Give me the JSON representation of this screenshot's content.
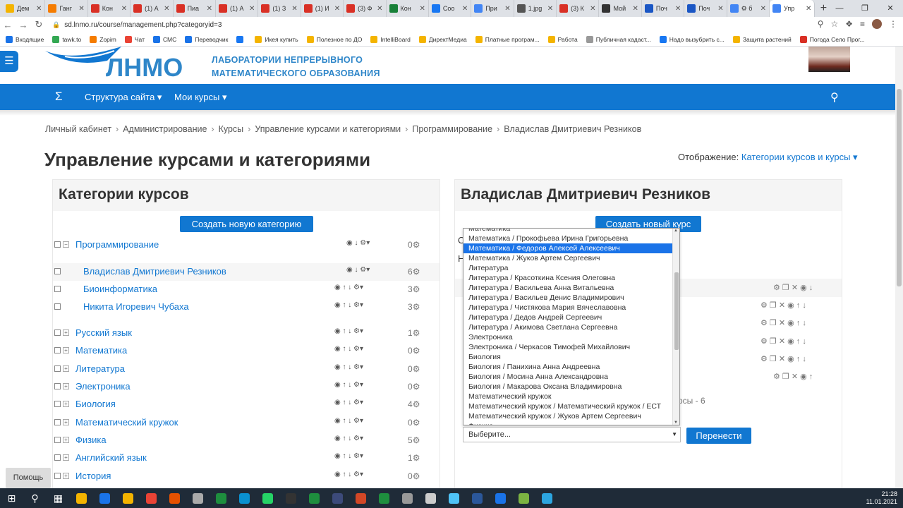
{
  "browser": {
    "tabs": [
      {
        "label": "Дем",
        "color": "#f4b400"
      },
      {
        "label": "Ганг",
        "color": "#f57c00"
      },
      {
        "label": "Кон",
        "color": "#d93025"
      },
      {
        "label": "(1) А",
        "color": "#d93025"
      },
      {
        "label": "Пиа",
        "color": "#d93025"
      },
      {
        "label": "(1) А",
        "color": "#d93025"
      },
      {
        "label": "(1) З",
        "color": "#d93025"
      },
      {
        "label": "(1) И",
        "color": "#d93025"
      },
      {
        "label": "(3) Ф",
        "color": "#d93025"
      },
      {
        "label": "Кон",
        "color": "#188038"
      },
      {
        "label": "Соо",
        "color": "#1877f2"
      },
      {
        "label": "При",
        "color": "#4285f4"
      },
      {
        "label": "1.jpg",
        "color": "#555555"
      },
      {
        "label": "(3) К",
        "color": "#d93025"
      },
      {
        "label": "Мой",
        "color": "#333333"
      },
      {
        "label": "Поч",
        "color": "#1a56c4"
      },
      {
        "label": "Поч",
        "color": "#1a56c4"
      },
      {
        "label": "⚙ б",
        "color": "#4285f4"
      },
      {
        "label": "Упр",
        "color": "#4285f4",
        "active": true
      }
    ],
    "url": "sd.lnmo.ru/course/management.php?categoryid=3",
    "bookmarks": [
      {
        "label": "Входящие",
        "color": "#1a73e8"
      },
      {
        "label": "tawk.to",
        "color": "#34a853"
      },
      {
        "label": "Zopim",
        "color": "#f57c00"
      },
      {
        "label": "Чат",
        "color": "#ea4335"
      },
      {
        "label": "СМС",
        "color": "#1a73e8"
      },
      {
        "label": "Переводчик",
        "color": "#1a73e8"
      },
      {
        "label": "",
        "color": "#1877f2"
      },
      {
        "label": "Икея купить",
        "color": "#f4b400"
      },
      {
        "label": "Полезное по ДО",
        "color": "#f4b400"
      },
      {
        "label": "IntelliBoard",
        "color": "#f4b400"
      },
      {
        "label": "ДиректМедиа",
        "color": "#f4b400"
      },
      {
        "label": "Платные програм...",
        "color": "#f4b400"
      },
      {
        "label": "Работа",
        "color": "#f4b400"
      },
      {
        "label": "Публичная кадаст...",
        "color": "#999999"
      },
      {
        "label": "Надо вызубрить с...",
        "color": "#1877f2"
      },
      {
        "label": "Защита растений",
        "color": "#f4b400"
      },
      {
        "label": "Погода Село Прог...",
        "color": "#d93025"
      }
    ]
  },
  "site": {
    "logo_word": "ЛНМО",
    "logo_line1": "ЛАБОРАТОРИИ НЕПРЕРЫВНОГО",
    "logo_line2": "МАТЕМАТИЧЕСКОГО ОБРАЗОВАНИЯ",
    "nav_sigma": "Σ",
    "nav_menu1": "Структура сайта ▾",
    "nav_menu2": "Мои курсы ▾",
    "search_icon": "🔍"
  },
  "breadcrumb": [
    "Личный кабинет",
    "Администрирование",
    "Курсы",
    "Управление курсами и категориями",
    "Программирование",
    "Владислав Дмитриевич Резников"
  ],
  "page_title": "Управление курсами и категориями",
  "view_mode_label": "Отображение:",
  "view_mode_value": "Категории курсов и курсы ▾",
  "left_panel": {
    "title": "Категории курсов",
    "create_button": "Создать новую категорию",
    "rows": [
      {
        "name": "Программирование",
        "count": "0",
        "indent": false,
        "expand": "−",
        "highlight": false,
        "up": false
      },
      {
        "name": "Владислав Дмитриевич Резников",
        "count": "6",
        "indent": true,
        "expand": "",
        "highlight": true,
        "up": false
      },
      {
        "name": "Биоинформатика",
        "count": "3",
        "indent": true,
        "expand": "",
        "highlight": false,
        "up": true
      },
      {
        "name": "Никита Игоревич Чубаха",
        "count": "3",
        "indent": true,
        "expand": "",
        "highlight": false,
        "up": true
      },
      {
        "name": "Русский язык",
        "count": "1",
        "indent": false,
        "expand": "+",
        "highlight": false,
        "up": true
      },
      {
        "name": "Математика",
        "count": "0",
        "indent": false,
        "expand": "+",
        "highlight": false,
        "up": true
      },
      {
        "name": "Литература",
        "count": "0",
        "indent": false,
        "expand": "+",
        "highlight": false,
        "up": true
      },
      {
        "name": "Электроника",
        "count": "0",
        "indent": false,
        "expand": "+",
        "highlight": false,
        "up": true
      },
      {
        "name": "Биология",
        "count": "4",
        "indent": false,
        "expand": "+",
        "highlight": false,
        "up": true
      },
      {
        "name": "Математический кружок",
        "count": "0",
        "indent": false,
        "expand": "+",
        "highlight": false,
        "up": true
      },
      {
        "name": "Физика",
        "count": "5",
        "indent": false,
        "expand": "+",
        "highlight": false,
        "up": true
      },
      {
        "name": "Английский язык",
        "count": "1",
        "indent": false,
        "expand": "+",
        "highlight": false,
        "up": true
      },
      {
        "name": "История",
        "count": "0",
        "indent": false,
        "expand": "+",
        "highlight": false,
        "up": true
      }
    ]
  },
  "right_panel": {
    "title": "Владислав Дмитриевич Резников",
    "create_button": "Создать новый курс",
    "partial_text_1": "О",
    "partial_text_2": "Н",
    "partial_courses": "рсы - 6",
    "move_button": "Перенести",
    "select_placeholder": "Выберите...",
    "dropdown_options": [
      "Математика",
      "Математика / Прокофьева Ирина Григорьевна",
      "Математика / Федоров Алексей Алексеевич",
      "Математика / Жуков Артем Сергеевич",
      "Литература",
      "Литература / Красоткина Ксения Олеговна",
      "Литература / Васильева Анна Витальевна",
      "Литература / Васильев Денис Владимирович",
      "Литература / Чистякова Мария Вячеславовна",
      "Литература / Дедов Андрей Сергеевич",
      "Литература / Акимова Светлана Сергеевна",
      "Электроника",
      "Электроника / Черкасов Тимофей Михайлович",
      "Биология",
      "Биология / Панихина Анна Андреевна",
      "Биология / Мосина Анна Александровна",
      "Биология / Макарова Оксана Владимировна",
      "Математический кружок",
      "Математический кружок / Математический кружок / ЕСТ",
      "Математический кружок / Жуков Артем Сергеевич",
      "Физика"
    ],
    "selected_index": 2
  },
  "help_button": "Помощь",
  "taskbar": {
    "time": "21:28",
    "date": "11.01.2021",
    "apps": [
      "#f4b400",
      "#1a73e8",
      "#f4b400",
      "#ea4335",
      "#e65100",
      "#aaaaaa",
      "#1e8e3e",
      "#0a91d0",
      "#25d366",
      "#333333",
      "#1e8e3e",
      "#3c4a7a",
      "#d24726",
      "#1e8e3e",
      "#999999",
      "#cccccc",
      "#4fc3f7",
      "#2b579a",
      "#1a73e8",
      "#7cb342",
      "#2ca5e0"
    ]
  }
}
